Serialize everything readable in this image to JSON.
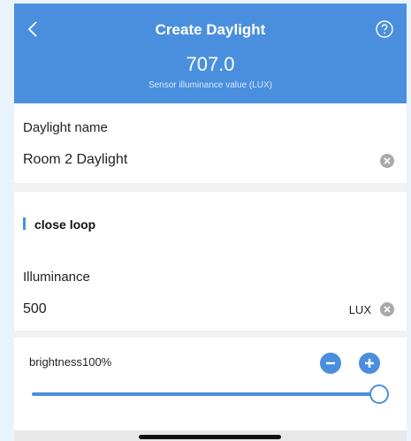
{
  "header": {
    "title": "Create Daylight",
    "sensor_value": "707.0",
    "sensor_label": "Sensor illuminance value (LUX)"
  },
  "daylight_name": {
    "label": "Daylight name",
    "value": "Room 2 Daylight"
  },
  "section": {
    "title": "close loop"
  },
  "illuminance": {
    "label": "Illuminance",
    "value": "500",
    "unit": "LUX"
  },
  "brightness": {
    "label": "brightness100%",
    "level_percent": 100
  },
  "icons": {
    "back": "chevron-left-icon",
    "help": "question-circle-icon",
    "clear": "clear-x-icon",
    "decrease": "minus-circle-icon",
    "increase": "plus-circle-icon"
  },
  "colors": {
    "accent": "#4a8fde",
    "background": "#e9f3fb"
  }
}
